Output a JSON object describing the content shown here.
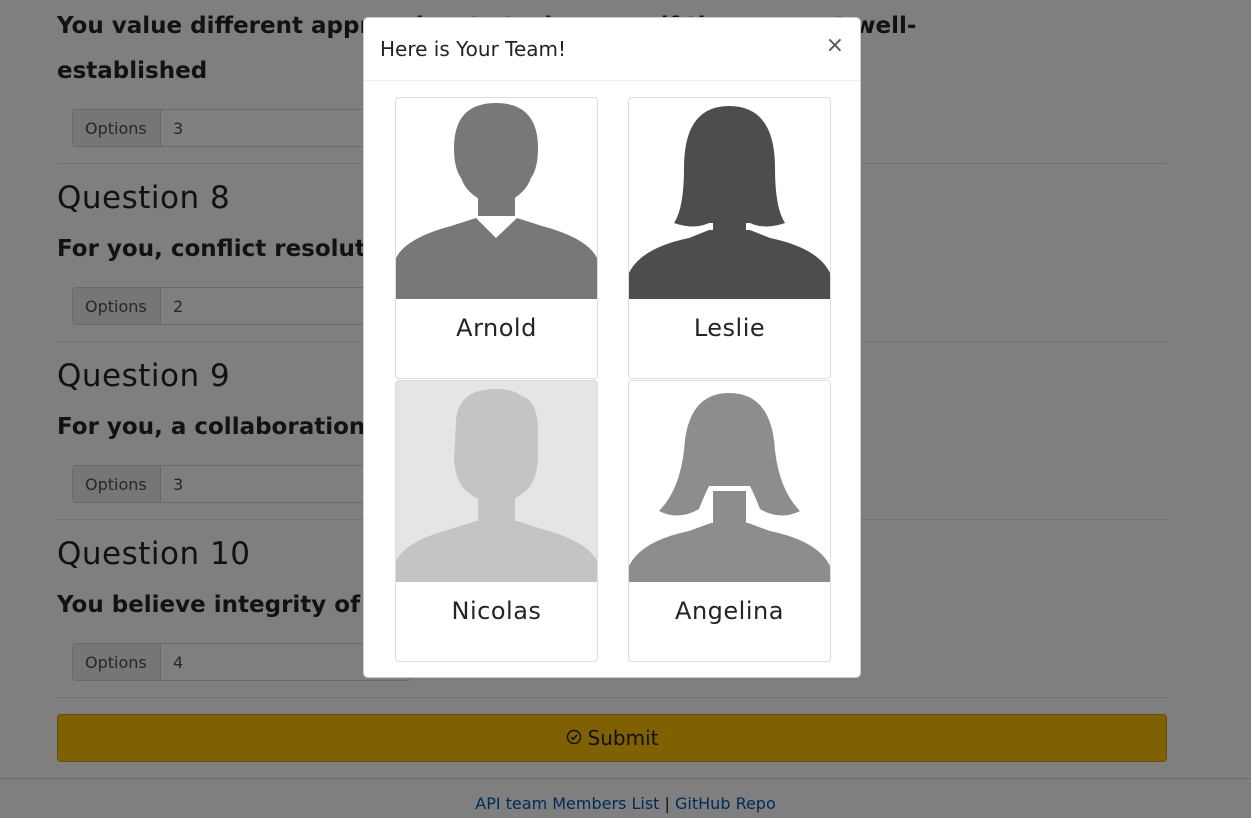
{
  "questions": {
    "q7": {
      "text_line1": "You value different approaches to tasks, even if they are not well-",
      "text_line2": "established",
      "option_prefix": "Options",
      "value": "3"
    },
    "q8": {
      "title": "Question 8",
      "text": "For you, conflict resolution is the key to working for success",
      "option_prefix": "Options",
      "value": "2"
    },
    "q9": {
      "title": "Question 9",
      "text": "For you, a collaboration means input from all parties",
      "option_prefix": "Options",
      "value": "3"
    },
    "q10": {
      "title": "Question 10",
      "text": "You believe integrity of co... is key to a successful team",
      "option_prefix": "Options",
      "value": "4"
    }
  },
  "submit": {
    "label": "Submit",
    "icon": "check-circle-icon"
  },
  "footer": {
    "link1": "API team Members List",
    "separator": "|",
    "link2": "GitHub Repo"
  },
  "modal": {
    "title": "Here is Your Team!",
    "close": "×",
    "members": [
      {
        "name": "Arnold",
        "icon": "male-suit-avatar-icon"
      },
      {
        "name": "Leslie",
        "icon": "female-avatar-icon"
      },
      {
        "name": "Nicolas",
        "icon": "male-avatar-icon"
      },
      {
        "name": "Angelina",
        "icon": "female-long-hair-avatar-icon"
      }
    ]
  },
  "colors": {
    "submit": "#ffc107",
    "link": "#0056b3",
    "backdrop": "rgba(0,0,0,0.5)"
  }
}
